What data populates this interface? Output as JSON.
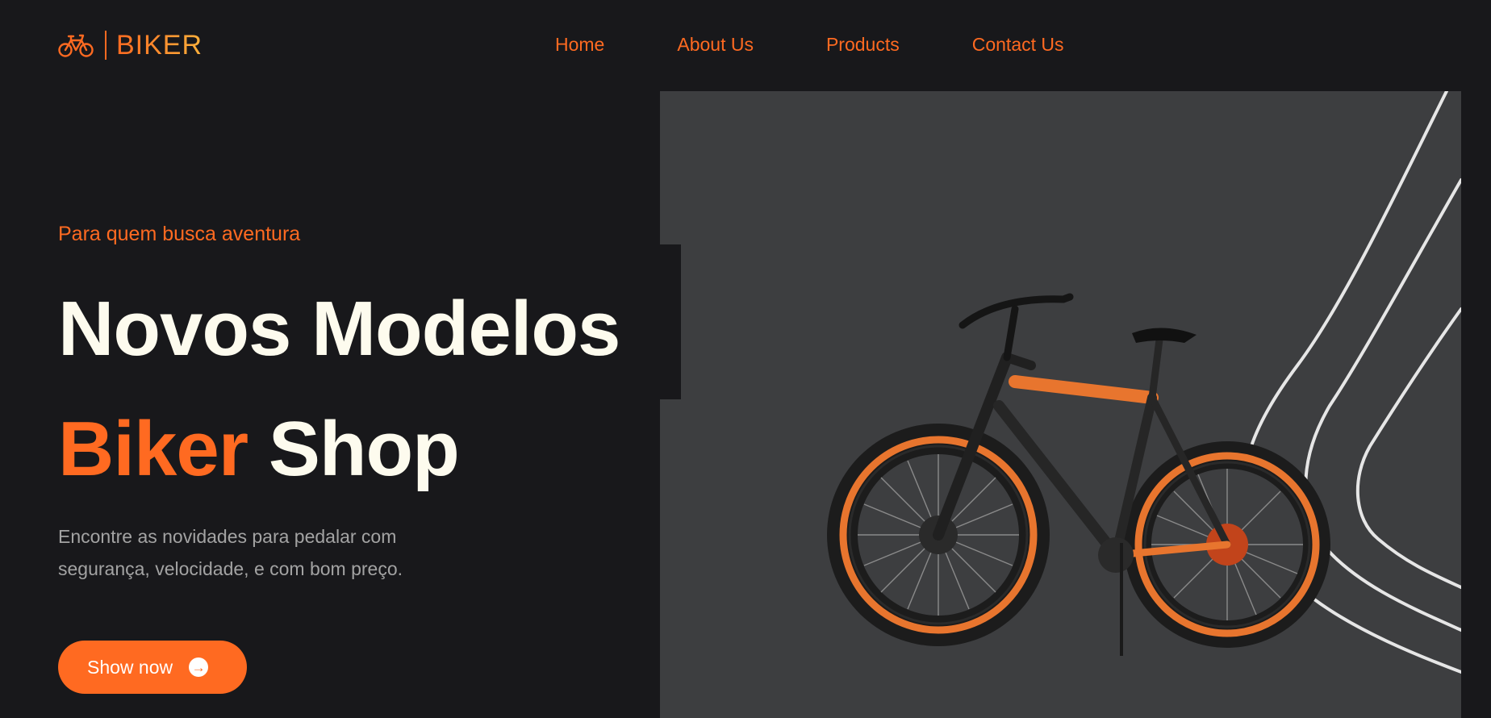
{
  "brand": {
    "name": "BIKER",
    "logo_icon": "bicycle-icon",
    "accent": "#ff6a21"
  },
  "nav": {
    "items": [
      {
        "label": "Home"
      },
      {
        "label": "About Us"
      },
      {
        "label": "Products"
      },
      {
        "label": "Contact Us"
      }
    ]
  },
  "hero": {
    "tagline": "Para quem busca aventura",
    "title_line1": "Novos Modelos",
    "title_accent": "Biker",
    "title_rest": "Shop",
    "description": "Encontre as novidades para pedalar com segurança, velocidade, e com bom preço.",
    "cta_label": "Show now",
    "cta_icon": "arrow-right-circle-icon",
    "image": "orange-bicycle-photo"
  },
  "colors": {
    "background": "#18181b",
    "accent": "#ff6a21",
    "title": "#fdfbee",
    "panel": "#3d3e40"
  }
}
